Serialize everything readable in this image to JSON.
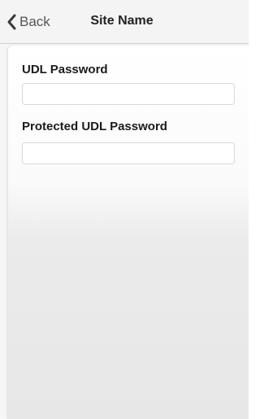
{
  "navbar": {
    "back_label": "Back",
    "title": "Site Name"
  },
  "form": {
    "udl_password": {
      "label": "UDL Password",
      "value": "",
      "placeholder": ""
    },
    "protected_udl_password": {
      "label": "Protected UDL Password",
      "value": "",
      "placeholder": ""
    }
  },
  "icons": {
    "back": "chevron-left-icon"
  },
  "colors": {
    "navbar_bg": "#f4f4f4",
    "title_text": "#222222",
    "back_text": "#555555",
    "label_text": "#1b1b1b"
  }
}
